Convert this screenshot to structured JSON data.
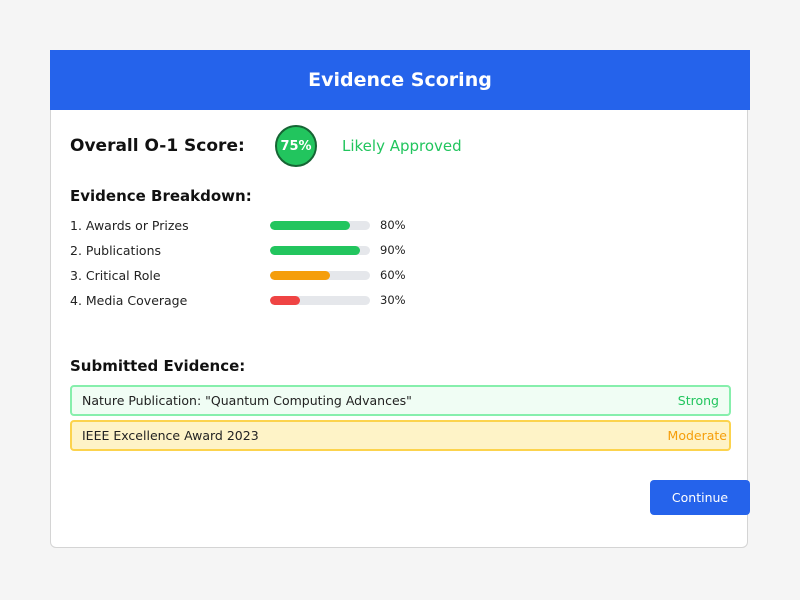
{
  "header": {
    "title": "Evidence Scoring"
  },
  "overall": {
    "label": "Overall O-1 Score:",
    "score_text": "75%",
    "score_value": 75,
    "status": "Likely Approved"
  },
  "breakdown": {
    "title": "Evidence Breakdown:",
    "items": [
      {
        "label": "1. Awards or Prizes",
        "value": 80,
        "value_text": "80%",
        "color": "#22c55e"
      },
      {
        "label": "2. Publications",
        "value": 90,
        "value_text": "90%",
        "color": "#22c55e"
      },
      {
        "label": "3. Critical Role",
        "value": 60,
        "value_text": "60%",
        "color": "#f59e0b"
      },
      {
        "label": "4. Media Coverage",
        "value": 30,
        "value_text": "30%",
        "color": "#ef4444"
      }
    ]
  },
  "evidence": {
    "title": "Submitted Evidence:",
    "items": [
      {
        "name": "Nature Publication: \"Quantum Computing Advances\"",
        "rating": "Strong",
        "rating_color": "#22c55e"
      },
      {
        "name": "IEEE Excellence Award 2023",
        "rating": "Moderate",
        "rating_color": "#f59e0b"
      }
    ]
  },
  "actions": {
    "continue_label": "Continue"
  },
  "colors": {
    "accent": "#2563eb",
    "success": "#22c55e",
    "warning": "#f59e0b",
    "danger": "#ef4444"
  }
}
